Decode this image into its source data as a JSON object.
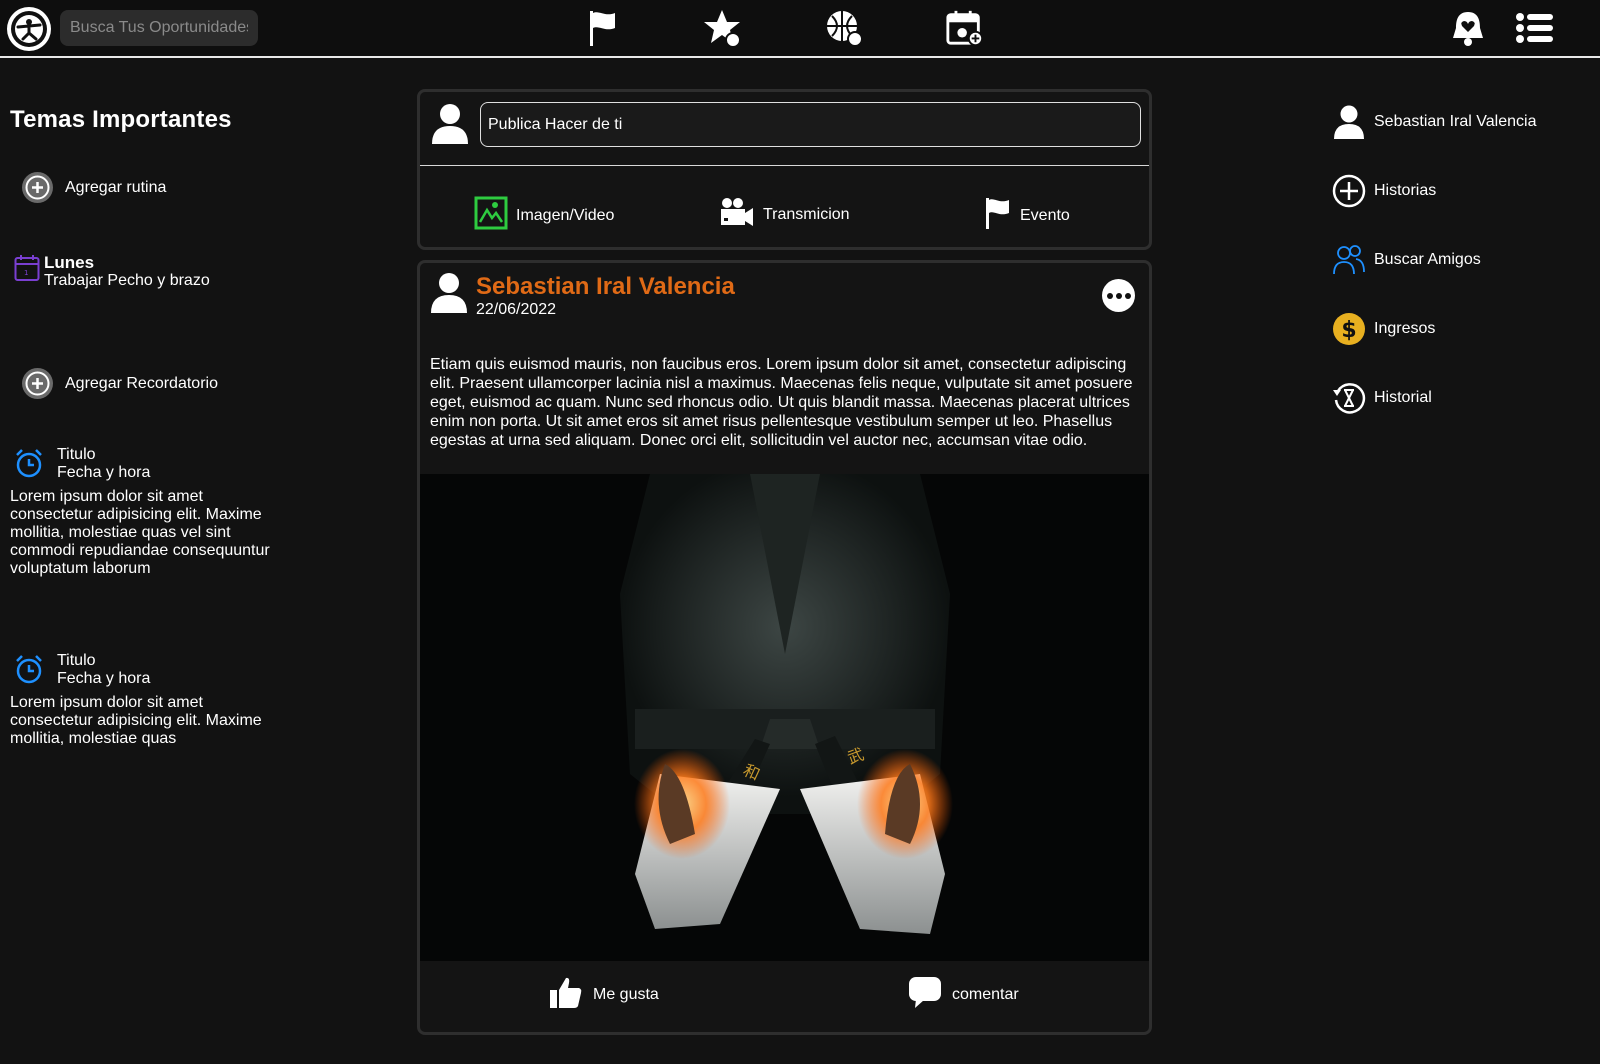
{
  "nav": {
    "search_placeholder": "Busca Tus Oportunidades",
    "icons": [
      "logo-icon",
      "flag-icon",
      "star-ball-icon",
      "globe-ball-icon",
      "calendar-add-icon",
      "bell-heart-icon",
      "menu-list-icon"
    ]
  },
  "left": {
    "title": "Temas Importantes",
    "add_routine": "Agregar rutina",
    "routine": {
      "day": "Lunes",
      "desc": "Trabajar Pecho y brazo"
    },
    "add_reminder": "Agregar Recordatorio",
    "reminders": [
      {
        "title": "Titulo",
        "datetime": "Fecha y hora",
        "body": "Lorem ipsum dolor sit amet consectetur adipisicing elit. Maxime mollitia, molestiae quas vel sint commodi repudiandae consequuntur voluptatum laborum"
      },
      {
        "title": "Titulo",
        "datetime": "Fecha y hora",
        "body": "Lorem ipsum dolor sit amet consectetur adipisicing elit. Maxime mollitia, molestiae quas"
      }
    ]
  },
  "composer": {
    "placeholder": "Publica Hacer de ti",
    "options": [
      "Imagen/Video",
      "Transmicion",
      "Evento"
    ]
  },
  "post": {
    "author": "Sebastian Iral Valencia",
    "date": "22/06/2022",
    "text": "Etiam quis euismod mauris, non faucibus eros. Lorem ipsum dolor sit amet, consectetur adipiscing elit. Praesent ullamcorper lacinia nisl a maximus. Maecenas felis neque, vulputate sit amet posuere eget, euismod ac quam. Nunc sed rhoncus odio. Ut quis blandit massa. Maecenas placerat ultrices enim non porta. Ut sit amet eros sit amet risus pellentesque vestibulum semper ut leo. Phasellus egestas at urna sed aliquam. Donec orci elit, sollicitudin vel auctor nec, accumsan vitae odio.",
    "like": "Me gusta",
    "comment": "comentar"
  },
  "right": {
    "items": [
      "Sebastian Iral Valencia",
      "Historias",
      "Buscar Amigos",
      "Ingresos",
      "Historial"
    ]
  },
  "colors": {
    "accent": "#e06a16",
    "calendar": "#7a3fd1",
    "alarm": "#1e90ff",
    "friends": "#1e90ff",
    "coin": "#e8b020",
    "media": "#2ecc40"
  }
}
